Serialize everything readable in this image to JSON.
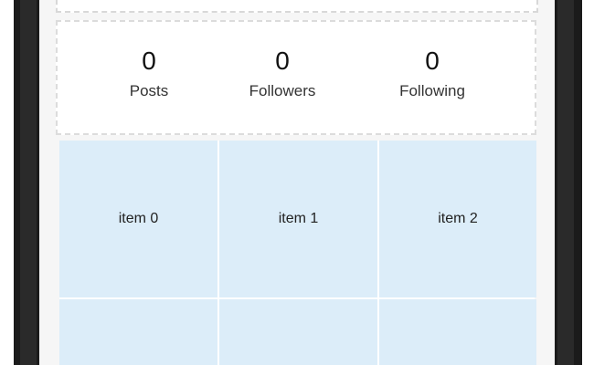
{
  "profile": {
    "stats": [
      {
        "value": "0",
        "label": "Posts"
      },
      {
        "value": "0",
        "label": "Followers"
      },
      {
        "value": "0",
        "label": "Following"
      }
    ]
  },
  "grid": {
    "items": [
      "item 0",
      "item 1",
      "item 2",
      "",
      "",
      ""
    ]
  },
  "colors": {
    "grid_item_bg": "#dcedf9",
    "bezel": "#1b1b1b",
    "screen_bg": "#f6f6f6"
  }
}
